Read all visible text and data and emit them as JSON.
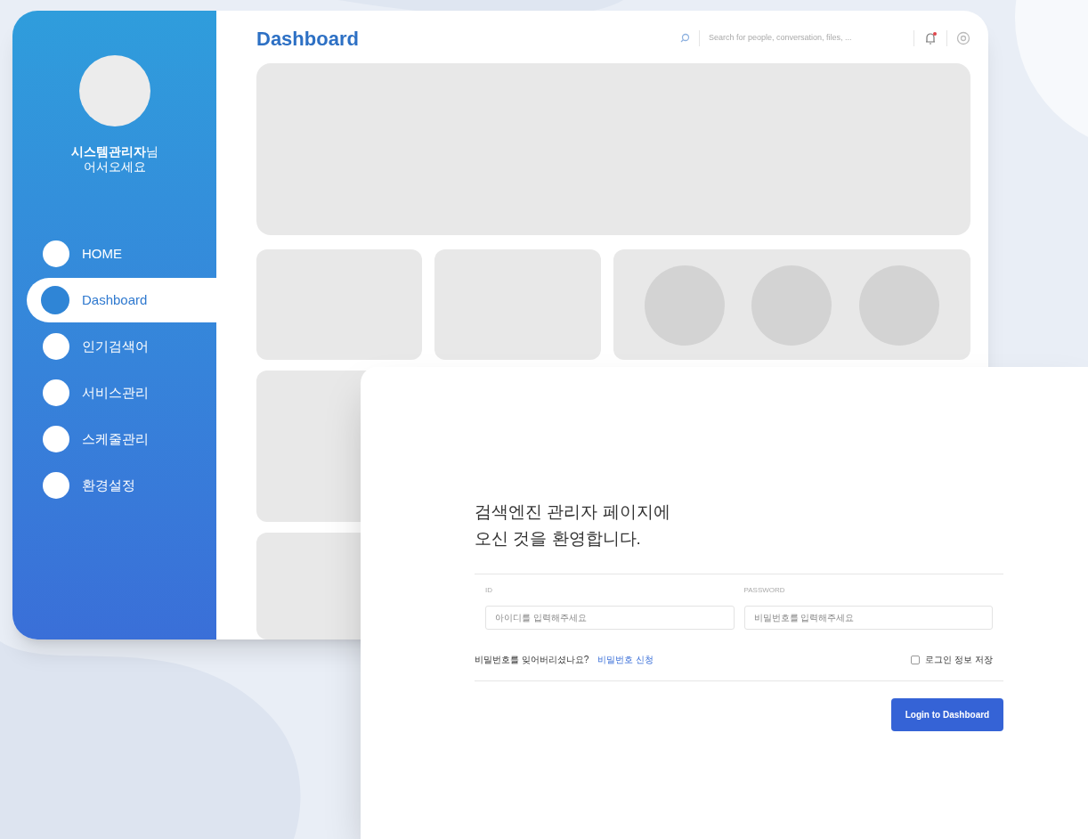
{
  "dashboard": {
    "title": "Dashboard",
    "search": {
      "placeholder": "Search for people, conversation, files, ..."
    },
    "notification": {
      "unread": true
    },
    "user": {
      "greeting": "**시스템관리자**님",
      "greeting_line2": "어서오세요"
    },
    "menu": [
      {
        "label": "HOME",
        "selected": false
      },
      {
        "label": "Dashboard",
        "selected": true
      },
      {
        "label": "인기검색어",
        "selected": false
      },
      {
        "label": "서비스관리",
        "selected": false
      },
      {
        "label": "스케줄관리",
        "selected": false
      },
      {
        "label": "환경설정",
        "selected": false
      }
    ]
  },
  "login": {
    "heading_lines": [
      "검색엔진 관리자 페이지에",
      "오신 것을 환영합니다."
    ],
    "fields": [
      {
        "label": "ID",
        "placeholder": "아이디를 입력해주세요"
      },
      {
        "label": "PASSWORD",
        "placeholder": "비밀번호를 입력해주세요"
      }
    ],
    "forgot_text": "비밀번호를 잊어버리셨나요?",
    "forgot_link": "비밀번호 신청",
    "remember": {
      "label": "로그인 정보 저장",
      "checked": false
    },
    "button": "Login to Dashboard"
  }
}
